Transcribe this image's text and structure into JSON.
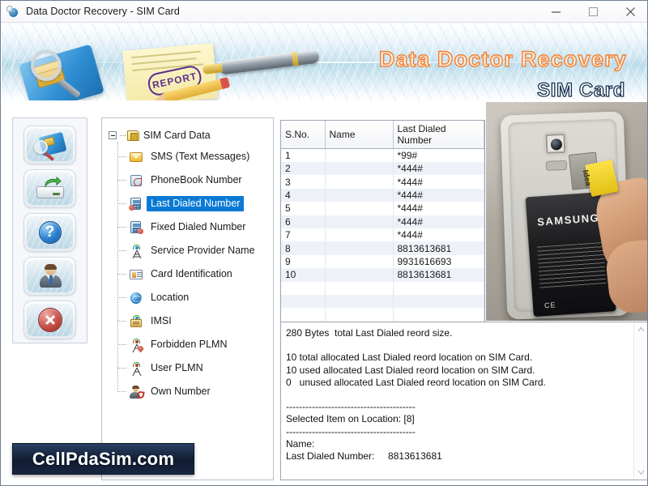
{
  "window": {
    "title": "Data Doctor Recovery - SIM Card",
    "icon": "app-globe-magnifier-icon",
    "controls": {
      "minimize": "minimize-button",
      "maximize": "maximize-button",
      "close": "close-button"
    }
  },
  "banner": {
    "brand": "Data Doctor Recovery",
    "product": "SIM Card",
    "brand_color": "#f08030",
    "product_color": "#16314f",
    "artwork": {
      "report_stamp": "REPORT"
    }
  },
  "sidebar": {
    "buttons": [
      {
        "name": "search-sim-card",
        "icon": "sim-card-magnifier-icon"
      },
      {
        "name": "save-recovered-data",
        "icon": "drive-save-arrow-icon"
      },
      {
        "name": "help",
        "icon": "question-mark-icon",
        "glyph": "?"
      },
      {
        "name": "support",
        "icon": "user-support-icon"
      },
      {
        "name": "exit",
        "icon": "close-cross-icon",
        "glyph": "✕"
      }
    ]
  },
  "tree": {
    "root": {
      "label": "SIM Card Data",
      "icon": "sim-card-icon",
      "expanded": true
    },
    "items": [
      {
        "label": "SMS (Text Messages)",
        "icon": "envelope-icon",
        "selected": false
      },
      {
        "label": "PhoneBook Number",
        "icon": "phonebook-icon",
        "selected": false
      },
      {
        "label": "Last Dialed Number",
        "icon": "last-dialed-icon",
        "selected": true
      },
      {
        "label": "Fixed Dialed Number",
        "icon": "fixed-dialed-icon",
        "selected": false
      },
      {
        "label": "Service Provider Name",
        "icon": "tower-icon",
        "selected": false
      },
      {
        "label": "Card Identification",
        "icon": "id-card-icon",
        "selected": false
      },
      {
        "label": "Location",
        "icon": "globe-icon",
        "selected": false
      },
      {
        "label": "IMSI",
        "icon": "imsi-tower-icon",
        "selected": false
      },
      {
        "label": "Forbidden PLMN",
        "icon": "forbidden-tower-icon",
        "selected": false
      },
      {
        "label": "User PLMN",
        "icon": "user-tower-icon",
        "selected": false
      },
      {
        "label": "Own Number",
        "icon": "own-number-icon",
        "selected": false
      }
    ],
    "selection_color": "#0a7ad4"
  },
  "table": {
    "columns": [
      "S.No.",
      "Name",
      "Last Dialed Number"
    ],
    "rows": [
      {
        "sno": "1",
        "name": "",
        "number": "*99#"
      },
      {
        "sno": "2",
        "name": "",
        "number": "*444#"
      },
      {
        "sno": "3",
        "name": "",
        "number": "*444#"
      },
      {
        "sno": "4",
        "name": "",
        "number": "*444#"
      },
      {
        "sno": "5",
        "name": "",
        "number": "*444#"
      },
      {
        "sno": "6",
        "name": "",
        "number": "*444#"
      },
      {
        "sno": "7",
        "name": "",
        "number": "*444#"
      },
      {
        "sno": "8",
        "name": "",
        "number": "8813613681"
      },
      {
        "sno": "9",
        "name": "",
        "number": "9931616693"
      },
      {
        "sno": "10",
        "name": "",
        "number": "8813613681"
      },
      {
        "sno": "",
        "name": "",
        "number": ""
      },
      {
        "sno": "",
        "name": "",
        "number": ""
      },
      {
        "sno": "",
        "name": "",
        "number": ""
      },
      {
        "sno": "",
        "name": "",
        "number": ""
      },
      {
        "sno": "",
        "name": "",
        "number": ""
      },
      {
        "sno": "",
        "name": "",
        "number": ""
      },
      {
        "sno": "",
        "name": "",
        "number": ""
      },
      {
        "sno": "",
        "name": "",
        "number": ""
      },
      {
        "sno": "",
        "name": "",
        "number": ""
      },
      {
        "sno": "",
        "name": "",
        "number": ""
      },
      {
        "sno": "",
        "name": "",
        "number": ""
      },
      {
        "sno": "",
        "name": "",
        "number": ""
      }
    ]
  },
  "photo": {
    "name": "samsung-phone-sim-insert-photo",
    "battery_brand": "SAMSUNG",
    "battery_mark": "CE",
    "sim_operator": "Idea"
  },
  "log": {
    "text": "280 Bytes  total Last Dialed reord size.\n\n10 total allocated Last Dialed reord location on SIM Card.\n10 used allocated Last Dialed reord location on SIM Card.\n0   unused allocated Last Dialed reord location on SIM Card.\n\n----------------------------------------\nSelected Item on Location: [8]\n----------------------------------------\nName:\nLast Dialed Number:     8813613681"
  },
  "watermark": {
    "text": "CellPdaSim.com"
  }
}
